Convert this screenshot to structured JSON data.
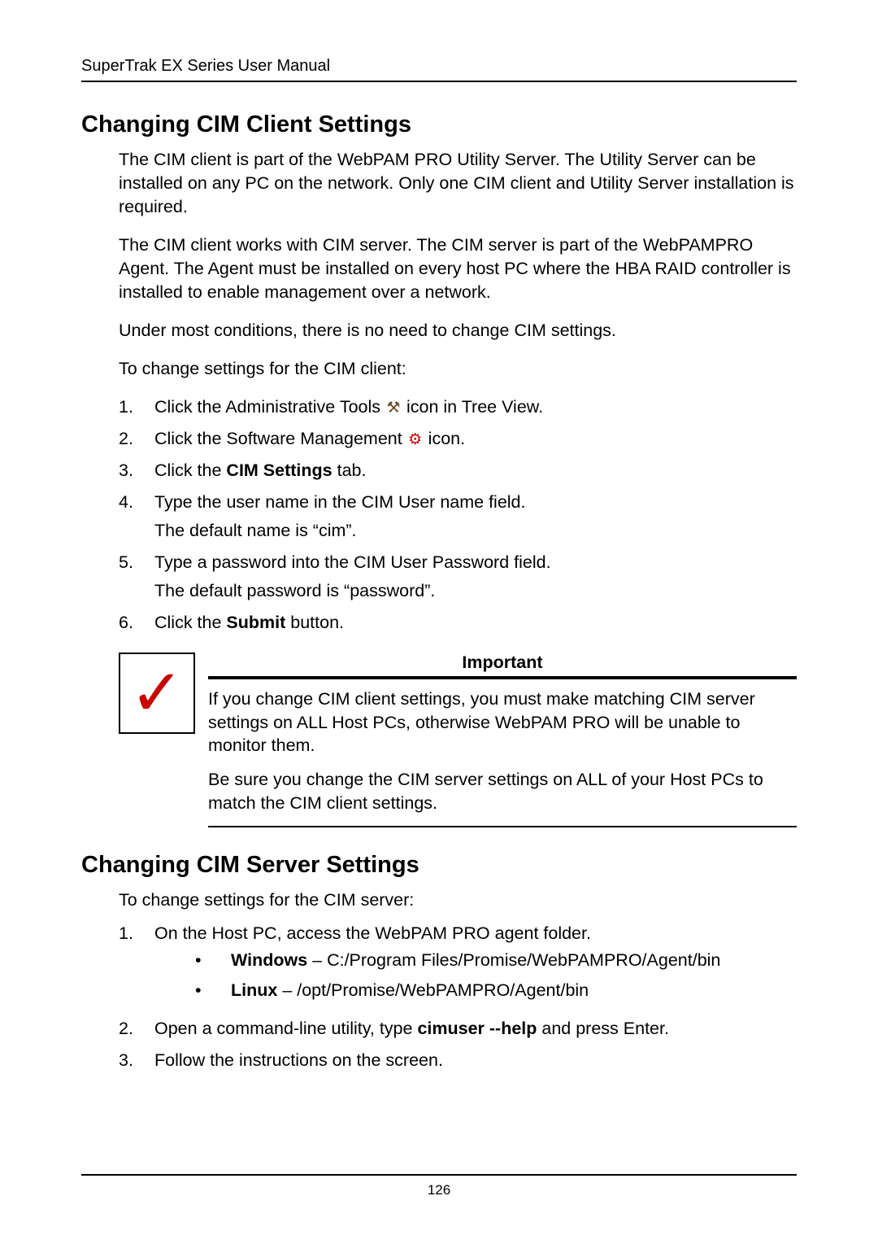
{
  "header": "SuperTrak EX Series User Manual",
  "page_number": "126",
  "s1": {
    "title": "Changing CIM Client Settings",
    "p1": "The CIM client is part of the WebPAM PRO Utility Server. The Utility Server can be installed on any PC on the network. Only one CIM client and Utility Server installation is required.",
    "p2": "The CIM client works with CIM server. The CIM server is part of the WebPAMPRO Agent. The Agent must be installed on every host PC where the HBA RAID controller is installed to enable management over a network.",
    "p3": "Under most conditions, there is no need to change CIM settings.",
    "p4": "To change settings for the CIM client:",
    "step1a": "Click the Administrative Tools ",
    "step1b": " icon in Tree View.",
    "step2a": "Click the Software Management ",
    "step2b": " icon.",
    "step3a": "Click the ",
    "step3b": "CIM Settings",
    "step3c": " tab.",
    "step4a": "Type the user name in the CIM User name field.",
    "step4b": "The default name is “cim”.",
    "step5a": "Type a password into the CIM User Password field.",
    "step5b": "The default password is “password”.",
    "step6a": "Click the ",
    "step6b": "Submit",
    "step6c": " button."
  },
  "note": {
    "title": "Important",
    "p1": " If you change CIM client settings, you must make matching CIM server settings on ALL Host PCs, otherwise WebPAM PRO will be unable to monitor them.",
    "p2": "Be sure you change the CIM server settings on ALL of your Host PCs to match the CIM client settings."
  },
  "s2": {
    "title": "Changing CIM Server Settings",
    "p1": "To change settings for the CIM server:",
    "step1": "On the Host PC, access the WebPAM PRO agent folder.",
    "bul1a": "Windows",
    "bul1b": " – C:/Program Files/Promise/WebPAMPRO/Agent/bin",
    "bul2a": "Linux",
    "bul2b": " – /opt/Promise/WebPAMPRO/Agent/bin",
    "step2a": "Open a command-line utility, type ",
    "step2b": "cimuser --help",
    "step2c": " and press Enter.",
    "step3": "Follow the instructions on the screen."
  },
  "icons": {
    "admin_tools": "⚒",
    "software_mgmt": "⚙"
  }
}
